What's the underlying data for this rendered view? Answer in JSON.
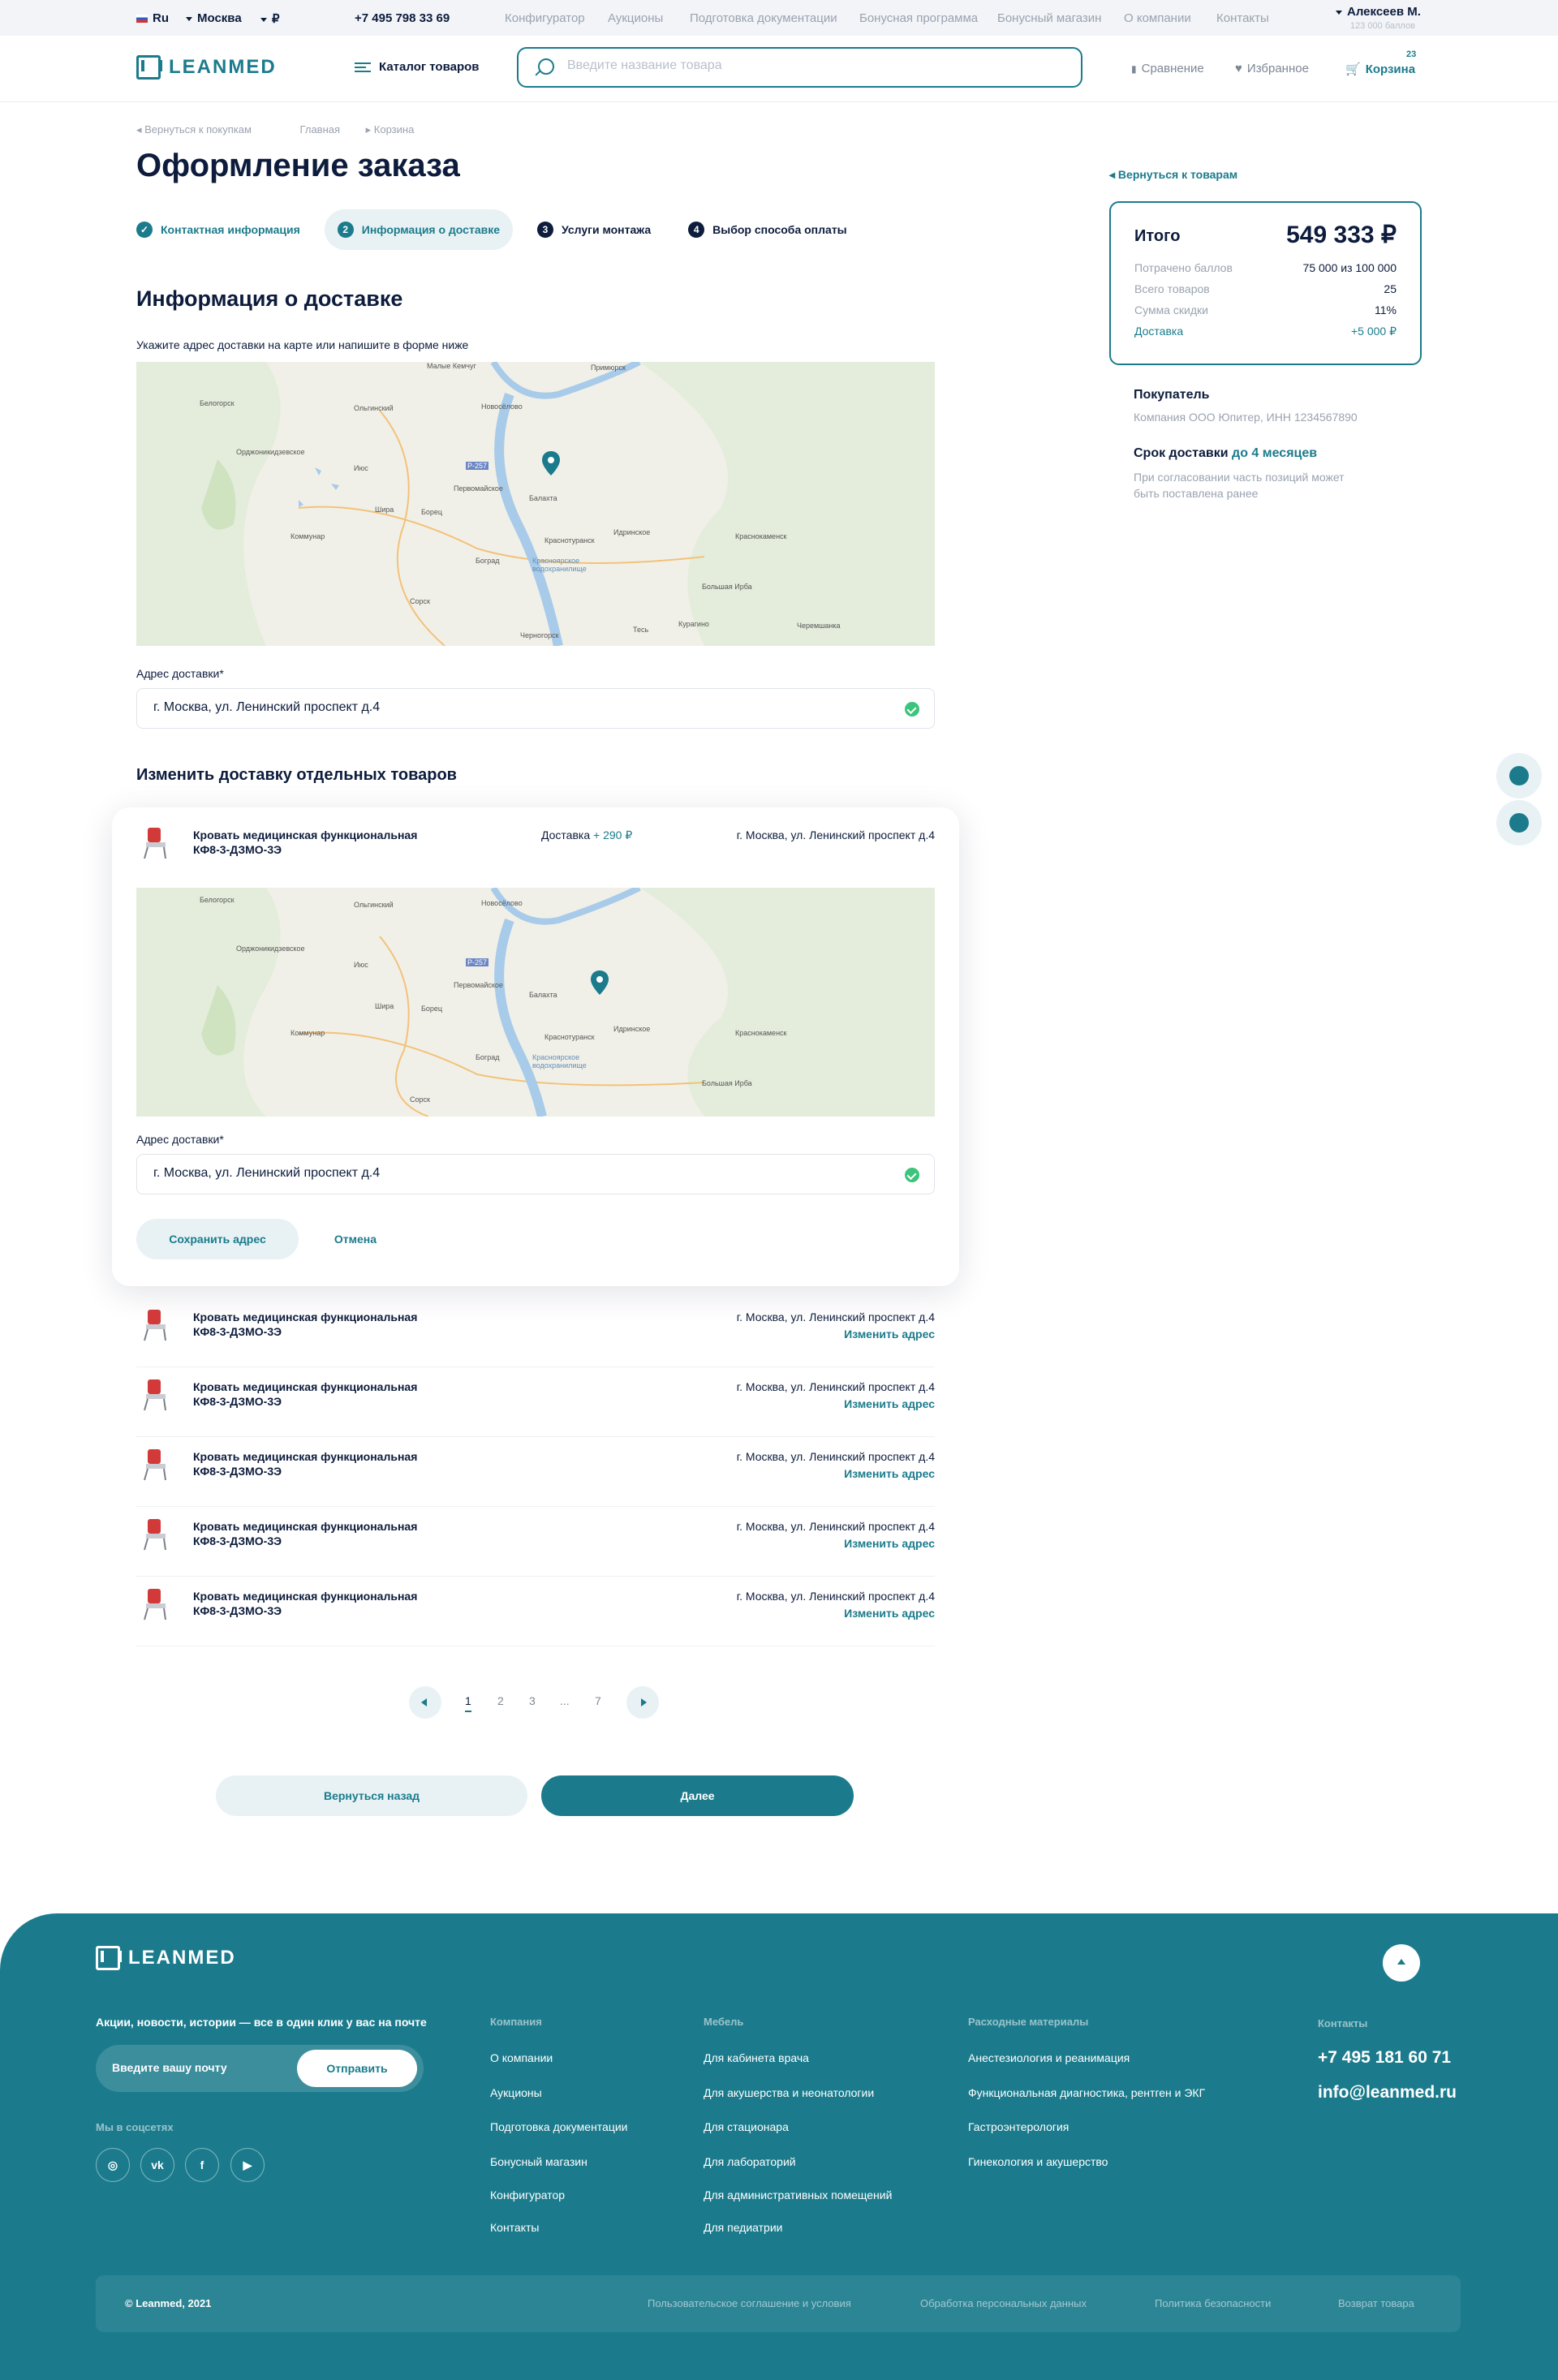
{
  "topbar": {
    "lang": "Ru",
    "city": "Москва",
    "currency": "₽",
    "phone": "+7 495 798 33 69",
    "links": [
      "Конфигуратор",
      "Аукционы",
      "Подготовка документации",
      "Бонусная программа",
      "Бонусный магазин",
      "О компании",
      "Контакты"
    ],
    "user_name": "Алексеев М.",
    "user_points": "123 000 баллов"
  },
  "header": {
    "logo": "LEANMED",
    "catalog": "Каталог товаров",
    "search_placeholder": "Введите название товара",
    "compare": "Сравнение",
    "favorites": "Избранное",
    "cart": "Корзина",
    "cart_count": "23"
  },
  "breadcrumbs": {
    "back": "Вернуться к покупкам",
    "home": "Главная",
    "cart": "Корзина"
  },
  "page_title": "Оформление заказа",
  "steps": [
    {
      "num": "✓",
      "label": "Контактная информация",
      "state": "done"
    },
    {
      "num": "2",
      "label": "Информация о доставке",
      "state": "active"
    },
    {
      "num": "3",
      "label": "Услуги монтажа",
      "state": "todo"
    },
    {
      "num": "4",
      "label": "Выбор способа оплаты",
      "state": "todo"
    }
  ],
  "delivery": {
    "heading": "Информация о доставке",
    "hint": "Укажите адрес доставки на карте или напишите в форме ниже",
    "address_label": "Адрес доставки*",
    "address_value": "г. Москва, ул. Ленинский проспект д.4"
  },
  "map_labels": {
    "m1": "Белогорск",
    "m2": "Ольгинский",
    "m3": "Новосёлово",
    "m4": "Примюрск",
    "m5": "Малые Кемчуг",
    "m6": "Орджоникидзевское",
    "m7": "Июс",
    "m8": "Первомайское",
    "m9": "Балахта",
    "m10": "Шира",
    "m11": "Борец",
    "m12": "Идринское",
    "m13": "Краснотуранск",
    "m14": "Коммунар",
    "m15": "Красноярское водохранилище",
    "m16": "Боград",
    "m17": "Краснокаменск",
    "m18": "Большая Ирба",
    "m19": "Сорск",
    "m20": "Тесь",
    "m21": "Курагино",
    "m22": "Черемшанка",
    "m23": "Черногорск",
    "m24": "Р-257"
  },
  "items_section": {
    "heading": "Изменить доставку отдельных товаров",
    "edit": {
      "name_line1": "Кровать медицинская функциональная",
      "name_line2": "КФ8-3-ДЗМО-3Э",
      "delivery_label": "Доставка",
      "delivery_price": "+ 290 ₽",
      "address": "г. Москва, ул. Ленинский проспект д.4",
      "address_label": "Адрес доставки*",
      "address_value": "г. Москва, ул. Ленинский проспект д.4",
      "save": "Сохранить адрес",
      "cancel": "Отмена"
    },
    "items": [
      {
        "name_line1": "Кровать медицинская функциональная",
        "name_line2": "КФ8-3-ДЗМО-3Э",
        "address": "г. Москва, ул. Ленинский проспект д.4",
        "change": "Изменить адрес"
      },
      {
        "name_line1": "Кровать медицинская функциональная",
        "name_line2": "КФ8-3-ДЗМО-3Э",
        "address": "г. Москва, ул. Ленинский проспект д.4",
        "change": "Изменить адрес"
      },
      {
        "name_line1": "Кровать медицинская функциональная",
        "name_line2": "КФ8-3-ДЗМО-3Э",
        "address": "г. Москва, ул. Ленинский проспект д.4",
        "change": "Изменить адрес"
      },
      {
        "name_line1": "Кровать медицинская функциональная",
        "name_line2": "КФ8-3-ДЗМО-3Э",
        "address": "г. Москва, ул. Ленинский проспект д.4",
        "change": "Изменить адрес"
      },
      {
        "name_line1": "Кровать медицинская функциональная",
        "name_line2": "КФ8-3-ДЗМО-3Э",
        "address": "г. Москва, ул. Ленинский проспект д.4",
        "change": "Изменить адрес"
      }
    ]
  },
  "pagination": {
    "pages": [
      "1",
      "2",
      "3",
      "...",
      "7"
    ],
    "current": "1"
  },
  "actions": {
    "back": "Вернуться назад",
    "next": "Далее"
  },
  "summary": {
    "back_to_goods": "Вернуться к товарам",
    "total_label": "Итого",
    "total_value": "549 333 ₽",
    "rows": [
      {
        "label": "Потрачено баллов",
        "value": "75 000 из 100 000"
      },
      {
        "label": "Всего товаров",
        "value": "25"
      },
      {
        "label": "Сумма скидки",
        "value": "11%"
      },
      {
        "label": "Доставка",
        "value": "+5 000 ₽"
      }
    ],
    "buyer_label": "Покупатель",
    "buyer_value": "Компания ООО Юпитер, ИНН 1234567890",
    "term_label": "Срок доставки",
    "term_value": "до 4 месяцев",
    "term_note": "При согласовании часть позиций может быть поставлена ранее"
  },
  "footer": {
    "logo": "LEANMED",
    "subscribe_heading": "Акции, новости, истории — все в один клик у вас на почте",
    "subscribe_placeholder": "Введите вашу почту",
    "subscribe_button": "Отправить",
    "social_heading": "Мы в соцсетях",
    "socials": [
      "instagram-icon",
      "vk-icon",
      "facebook-icon",
      "youtube-icon"
    ],
    "columns": [
      {
        "title": "Компания",
        "items": [
          "О компании",
          "Аукционы",
          "Подготовка документации",
          "Бонусный магазин",
          "Конфигуратор",
          "Контакты"
        ]
      },
      {
        "title": "Мебель",
        "items": [
          "Для кабинета врача",
          "Для акушерства и неонатологии",
          "Для стационара",
          "Для лабораторий",
          "Для административных помещений",
          "Для педиатрии"
        ]
      },
      {
        "title": "Расходные материалы",
        "items": [
          "Анестезиология и реанимация",
          "Функциональная диагностика, рентген и ЭКГ",
          "Гастроэнтерология",
          "Гинекология и акушерство"
        ]
      }
    ],
    "contacts_title": "Контакты",
    "phone": "+7 495 181 60 71",
    "email": "info@leanmed.ru",
    "copyright": "© Leanmed, 2021",
    "legal": [
      "Пользовательское соглашение и условия",
      "Обработка персональных данных",
      "Политика безопасности",
      "Возврат товара"
    ]
  },
  "colors": {
    "accent": "#1b7b8c",
    "text": "#0d1c3c",
    "muted": "#9aa3b0",
    "success": "#3cc47c"
  }
}
